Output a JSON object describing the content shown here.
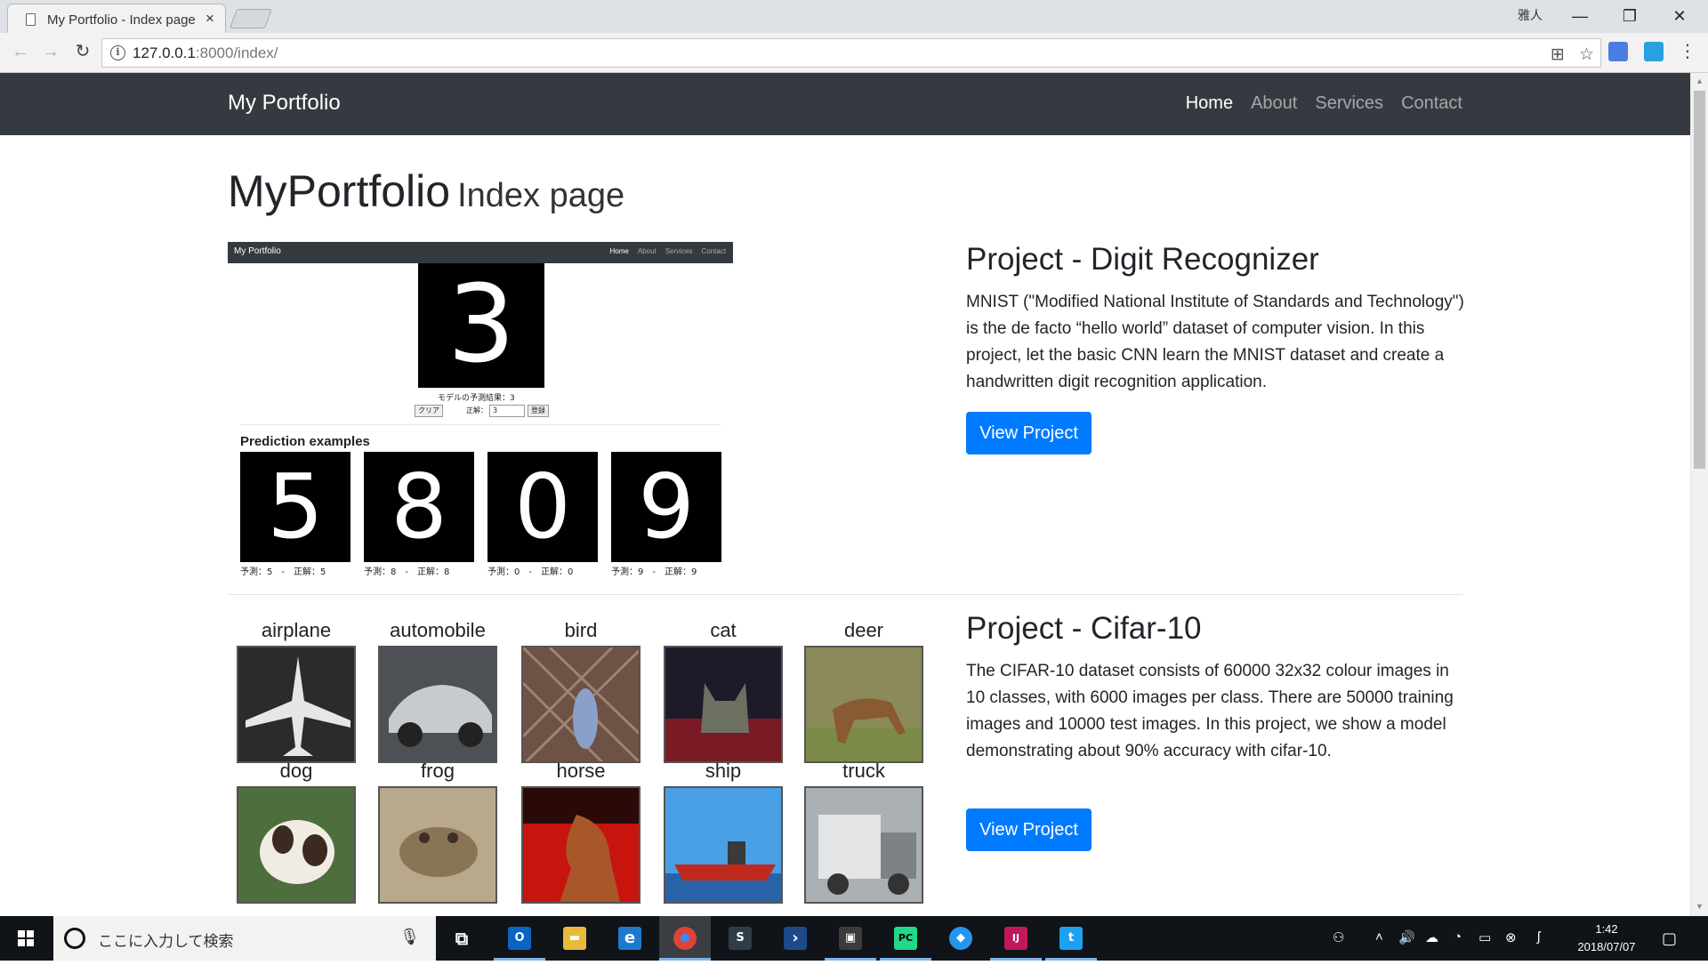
{
  "browser": {
    "tab_title": "My Portfolio - Index page",
    "tab_close": "×",
    "profile": "雅人",
    "url_host": "127.0.0.1",
    "url_path": ":8000/index/",
    "window_minimize": "—",
    "window_restore": "❐",
    "window_close": "✕"
  },
  "site": {
    "brand": "My Portfolio",
    "nav": [
      "Home",
      "About",
      "Services",
      "Contact"
    ],
    "active_nav": "Home",
    "heading_main": "MyPortfolio",
    "heading_small": "Index page"
  },
  "projects": [
    {
      "title": "Project - Digit Recognizer",
      "description": "MNIST (\"Modified National Institute of Standards and Technology\") is the de facto “hello world” dataset of computer vision. In this project, let the basic CNN learn the MNIST dataset and create a handwritten digit recognition application.",
      "button": "View Project"
    },
    {
      "title": "Project - Cifar-10",
      "description": "The CIFAR-10 dataset consists of 60000 32x32 colour images in 10 classes, with 6000 images per class. There are 50000 training images and 10000 test images. In this project, we show a model demonstrating about 90% accuracy with cifar-10.",
      "button": "View Project"
    }
  ],
  "mnist_preview": {
    "brand": "My Portfolio",
    "nav": [
      "Home",
      "About",
      "Services",
      "Contact"
    ],
    "main_digit": "3",
    "prediction_result": "モデルの予測結果：3",
    "clear_button": "クリア",
    "answer_label": "正解：",
    "answer_value": "3",
    "register_button": "登録",
    "examples_title": "Prediction examples",
    "examples": [
      {
        "digit": "5",
        "label": "予測：5　-　正解：5"
      },
      {
        "digit": "8",
        "label": "予測：8　-　正解：8"
      },
      {
        "digit": "0",
        "label": "予測：0　-　正解：0"
      },
      {
        "digit": "9",
        "label": "予測：9　-　正解：9"
      }
    ]
  },
  "cifar_preview": {
    "classes": [
      "airplane",
      "automobile",
      "bird",
      "cat",
      "deer",
      "dog",
      "frog",
      "horse",
      "ship",
      "truck"
    ],
    "tile_colors": [
      "#3a3a3a",
      "#5a5d60",
      "#7a5c4e",
      "#3b2a2e",
      "#7f7a55",
      "#6f7a5a",
      "#8a7a62",
      "#b02418",
      "#3f8fd6",
      "#9aa0a4"
    ]
  },
  "taskbar": {
    "search_placeholder": "ここに入力して検索",
    "time": "1:42",
    "date": "2018/07/07",
    "apps": [
      {
        "name": "task-view",
        "glyph": "⧉",
        "color": "#101317"
      },
      {
        "name": "outlook",
        "glyph": "O",
        "color": "#0a64c2"
      },
      {
        "name": "file-explorer",
        "glyph": "▬",
        "color": "#e8b93a"
      },
      {
        "name": "edge",
        "glyph": "e",
        "color": "#1e7ad1"
      },
      {
        "name": "chrome",
        "glyph": "●",
        "color": "#db4437"
      },
      {
        "name": "sourcetree",
        "glyph": "S",
        "color": "#2f3c4a"
      },
      {
        "name": "powershell",
        "glyph": "›",
        "color": "#1f4a8a"
      },
      {
        "name": "terminal",
        "glyph": "▣",
        "color": "#3b3b3b"
      },
      {
        "name": "pycharm",
        "glyph": "PC",
        "color": "#21d789"
      },
      {
        "name": "docker",
        "glyph": "◆",
        "color": "#2496ed"
      },
      {
        "name": "intellij",
        "glyph": "IJ",
        "color": "#c2185b"
      },
      {
        "name": "twitter",
        "glyph": "t",
        "color": "#1da1f2"
      }
    ]
  }
}
